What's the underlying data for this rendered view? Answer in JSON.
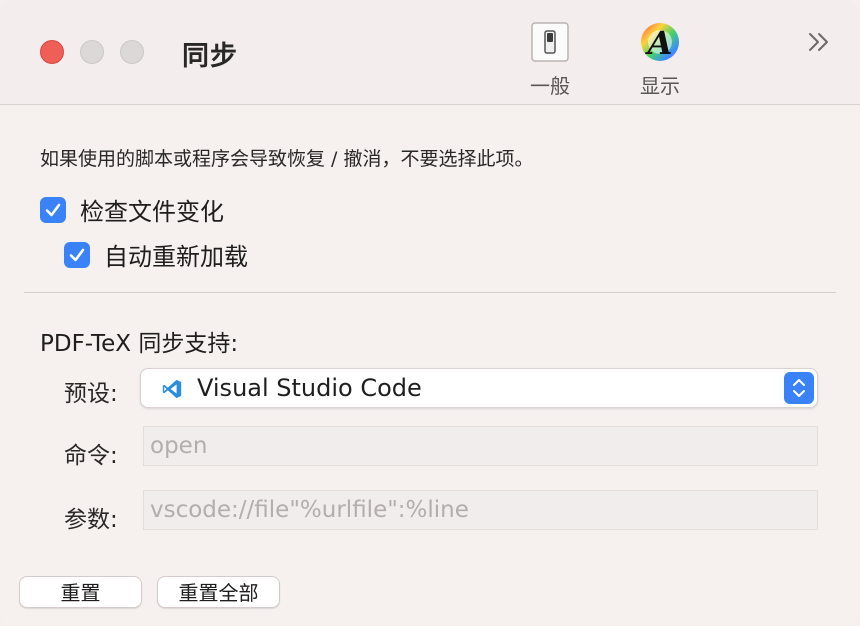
{
  "window": {
    "title": "同步"
  },
  "toolbar": {
    "items": [
      {
        "label": "一般",
        "icon": "switch-icon"
      },
      {
        "label": "显示",
        "icon": "font-color-icon"
      }
    ],
    "overflow_icon": "chevron-double-right-icon"
  },
  "warning_text": "如果使用的脚本或程序会导致恢复 / 撤消，不要选择此项。",
  "checkboxes": [
    {
      "label": "检查文件变化",
      "checked": true
    },
    {
      "label": "自动重新加载",
      "checked": true
    }
  ],
  "sync": {
    "section_title": "PDF-TeX 同步支持:",
    "preset_label": "预设:",
    "preset_value": "Visual Studio Code",
    "preset_icon": "vscode-icon",
    "command_label": "命令:",
    "command_placeholder": "open",
    "args_label": "参数:",
    "args_placeholder": "vscode://file\"%urlfile\":%line"
  },
  "buttons": {
    "reset": "重置",
    "reset_all": "重置全部"
  },
  "colors": {
    "accent": "#3a82f7",
    "close": "#ee5f57"
  }
}
